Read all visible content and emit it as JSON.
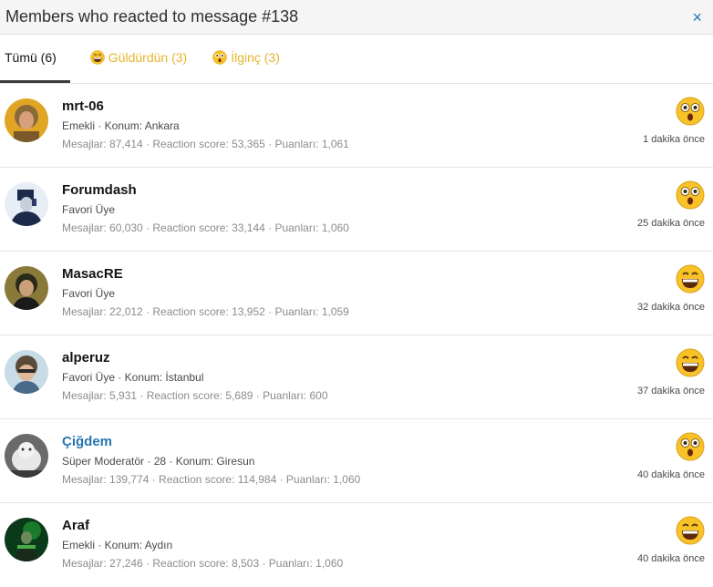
{
  "header": {
    "title": "Members who reacted to message #138",
    "close_label": "×"
  },
  "tabs": [
    {
      "label": "Tümü (6)",
      "kind": "all"
    },
    {
      "label": "Güldürdün (3)",
      "kind": "laugh"
    },
    {
      "label": "İlginç (3)",
      "kind": "wow"
    }
  ],
  "members": [
    {
      "name": "mrt-06",
      "details": "Emekli · Konum: Ankara",
      "stats": "Mesajlar: 87,414 · Reaction score: 53,365 · Puanları: 1,061",
      "reaction": "wow",
      "time": "1 dakika önce"
    },
    {
      "name": "Forumdash",
      "details": "Favori Üye",
      "stats": "Mesajlar: 60,030 · Reaction score: 33,144 · Puanları: 1,060",
      "reaction": "wow",
      "time": "25 dakika önce"
    },
    {
      "name": "MasacRE",
      "details": "Favori Üye",
      "stats": "Mesajlar: 22,012 · Reaction score: 13,952 · Puanları: 1,059",
      "reaction": "laugh",
      "time": "32 dakika önce"
    },
    {
      "name": "alperuz",
      "details": "Favori Üye · Konum: İstanbul",
      "stats": "Mesajlar: 5,931 · Reaction score: 5,689 · Puanları: 600",
      "reaction": "laugh",
      "time": "37 dakika önce"
    },
    {
      "name": "Çiğdem",
      "details": "Süper Moderatör · 28 · Konum: Giresun",
      "stats": "Mesajlar: 139,774 · Reaction score: 114,984 · Puanları: 1,060",
      "reaction": "wow",
      "time": "40 dakika önce"
    },
    {
      "name": "Araf",
      "details": "Emekli · Konum: Aydın",
      "stats": "Mesajlar: 27,246 · Reaction score: 8,503 · Puanları: 1,060",
      "reaction": "laugh",
      "time": "40 dakika önce"
    }
  ],
  "colors": {
    "accent": "#2577b1",
    "tab_reaction": "#e6b52c",
    "emoji_yellow": "#f8c228"
  }
}
